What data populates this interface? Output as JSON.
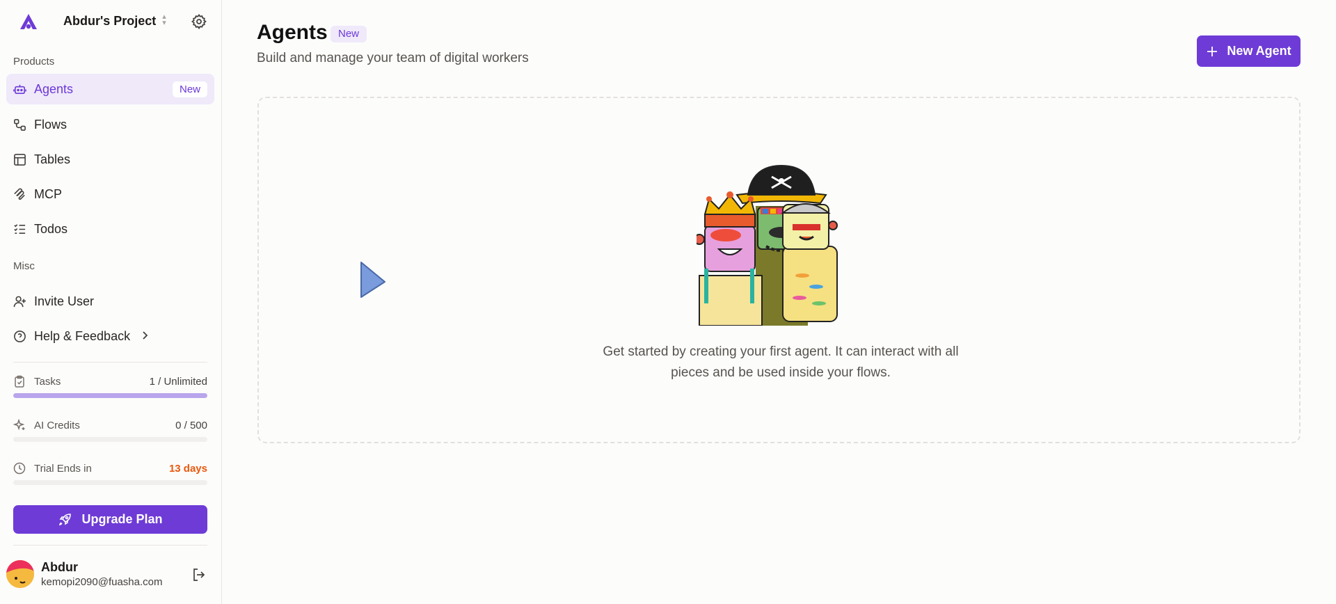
{
  "project": {
    "name": "Abdur's Project"
  },
  "sidebar": {
    "products_label": "Products",
    "misc_label": "Misc",
    "items": [
      {
        "label": "Agents",
        "badge": "New",
        "icon": "bot-icon",
        "active": true
      },
      {
        "label": "Flows",
        "icon": "flow-icon"
      },
      {
        "label": "Tables",
        "icon": "table-icon"
      },
      {
        "label": "MCP",
        "icon": "mcp-icon"
      },
      {
        "label": "Todos",
        "icon": "checklist-icon"
      }
    ],
    "misc_items": [
      {
        "label": "Invite User",
        "icon": "user-plus-icon"
      },
      {
        "label": "Help & Feedback",
        "icon": "help-circle-icon"
      }
    ]
  },
  "usage": {
    "tasks": {
      "label": "Tasks",
      "value": "1 / Unlimited",
      "fill": 1.0
    },
    "ai_credits": {
      "label": "AI Credits",
      "value": "0 / 500",
      "fill": 0
    },
    "trial": {
      "label": "Trial Ends in",
      "value": "13 days",
      "fill": 0
    }
  },
  "upgrade": {
    "label": "Upgrade Plan"
  },
  "user": {
    "name": "Abdur",
    "email": "kemopi2090@fuasha.com"
  },
  "page": {
    "title": "Agents",
    "title_badge": "New",
    "subtitle": "Build and manage your team of digital workers",
    "new_button": "New Agent",
    "empty_line1": "Get started by creating your first agent. It can interact with all",
    "empty_line2": "pieces and be used inside your flows."
  },
  "colors": {
    "accent": "#6e3bd6",
    "accent_soft": "#efe9fa",
    "warning": "#ea580c"
  }
}
